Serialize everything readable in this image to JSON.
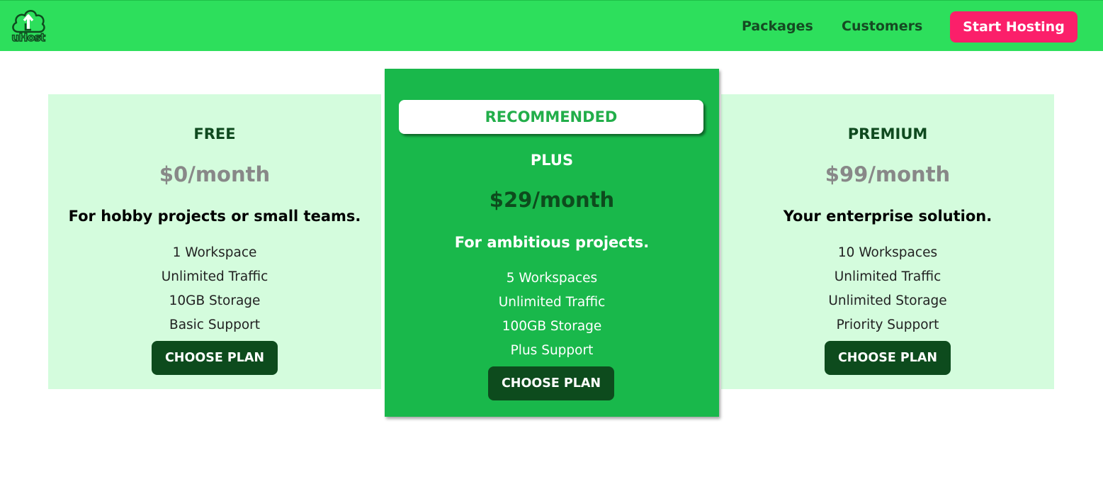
{
  "header": {
    "logo_text": "uHost",
    "nav": [
      "Packages",
      "Customers"
    ],
    "cta_label": "Start Hosting"
  },
  "plans": [
    {
      "name": "FREE",
      "price": "$0/month",
      "description": "For hobby projects or small teams.",
      "features": [
        "1 Workspace",
        "Unlimited Traffic",
        "10GB Storage",
        "Basic Support"
      ],
      "button": "CHOOSE PLAN"
    },
    {
      "badge": "RECOMMENDED",
      "name": "PLUS",
      "price": "$29/month",
      "description": "For ambitious projects.",
      "features": [
        "5 Workspaces",
        "Unlimited Traffic",
        "100GB Storage",
        "Plus Support"
      ],
      "button": "CHOOSE PLAN"
    },
    {
      "name": "PREMIUM",
      "price": "$99/month",
      "description": "Your enterprise solution.",
      "features": [
        "10 Workspaces",
        "Unlimited Traffic",
        "Unlimited Storage",
        "Priority Support"
      ],
      "button": "CHOOSE PLAN"
    }
  ],
  "colors": {
    "header_bg": "#2ddf5c",
    "cta_bg": "#fb1f6a",
    "card_bg": "#d4fcdd",
    "featured_bg": "#19b84b",
    "button_bg": "#0d4b1d",
    "dark_green_text": "#0f4a1f",
    "price_gray": "#888888"
  },
  "icons": {
    "logo": "cloud-upload-icon"
  }
}
